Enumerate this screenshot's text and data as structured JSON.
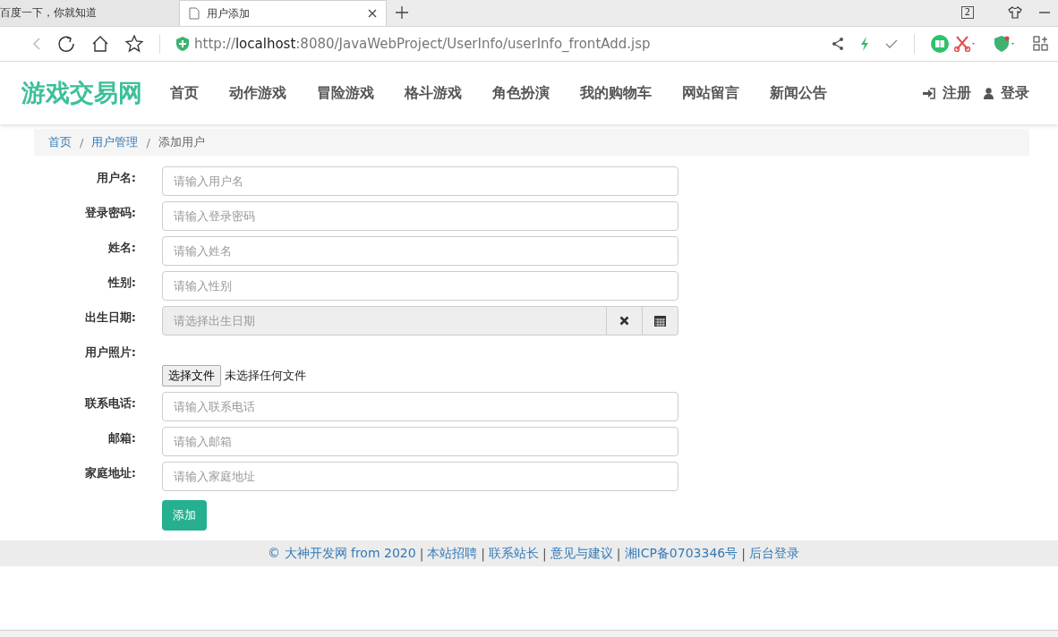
{
  "browser": {
    "tabs": [
      {
        "label": "百度一下，你就知道",
        "selected": false
      },
      {
        "label": "用户添加",
        "selected": true
      }
    ],
    "tab_count": "2",
    "url": {
      "scheme": "http://",
      "host": "localhost",
      "rest": ":8080/JavaWebProject/UserInfo/userInfo_frontAdd.jsp"
    }
  },
  "site": {
    "logo": "游戏交易网",
    "nav": [
      "首页",
      "动作游戏",
      "冒险游戏",
      "格斗游戏",
      "角色扮演",
      "我的购物车",
      "网站留言",
      "新闻公告"
    ],
    "actions": [
      {
        "kind": "register",
        "label": "注册"
      },
      {
        "kind": "login",
        "label": "登录"
      }
    ]
  },
  "breadcrumb": [
    {
      "label": "首页",
      "link": true
    },
    {
      "label": "用户管理",
      "link": true
    },
    {
      "label": "添加用户",
      "link": false
    }
  ],
  "breadcrumb_separator": "/",
  "form": {
    "fields": [
      {
        "kind": "text",
        "label": "用户名:",
        "placeholder": "请输入用户名"
      },
      {
        "kind": "text",
        "label": "登录密码:",
        "placeholder": "请输入登录密码"
      },
      {
        "kind": "text",
        "label": "姓名:",
        "placeholder": "请输入姓名"
      },
      {
        "kind": "text",
        "label": "性别:",
        "placeholder": "请输入性别"
      },
      {
        "kind": "date",
        "label": "出生日期:",
        "placeholder": "请选择出生日期"
      },
      {
        "kind": "file",
        "label": "用户照片:",
        "button": "选择文件",
        "status": "未选择任何文件"
      },
      {
        "kind": "text",
        "label": "联系电话:",
        "placeholder": "请输入联系电话"
      },
      {
        "kind": "text",
        "label": "邮箱:",
        "placeholder": "请输入邮箱"
      },
      {
        "kind": "text",
        "label": "家庭地址:",
        "placeholder": "请输入家庭地址"
      }
    ],
    "submit": "添加"
  },
  "footer": {
    "items": [
      "© 大神开发网 from 2020",
      "本站招聘",
      "联系站长",
      "意见与建议",
      "湘ICP备0703346号",
      "后台登录"
    ],
    "separator": "|"
  }
}
